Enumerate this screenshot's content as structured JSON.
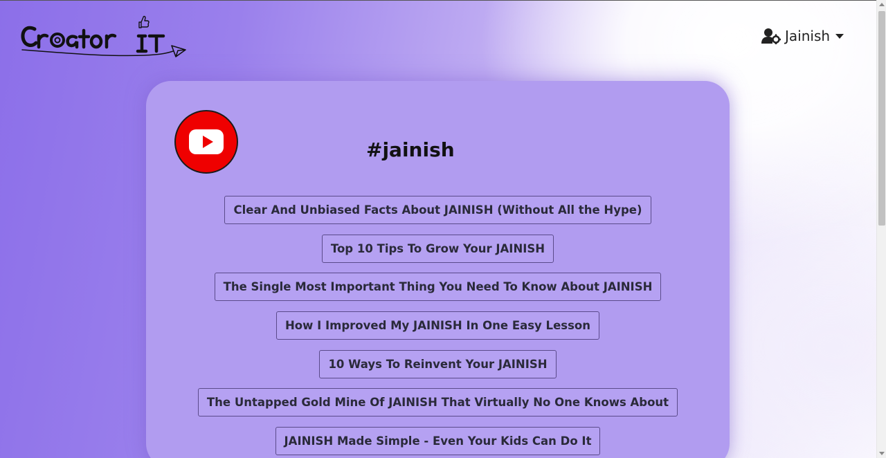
{
  "brand": {
    "logo_text": "Creator IT"
  },
  "user_menu": {
    "name": "Jainish",
    "icon": "user-gear-icon"
  },
  "card": {
    "platform_icon": "youtube-icon",
    "hashtag": "#jainish",
    "titles": [
      "Clear And Unbiased Facts About JAINISH (Without All the Hype)",
      "Top 10 Tips To Grow Your JAINISH",
      "The Single Most Important Thing You Need To Know About JAINISH",
      "How I Improved My JAINISH In One Easy Lesson",
      "10 Ways To Reinvent Your JAINISH",
      "The Untapped Gold Mine Of JAINISH That Virtually No One Knows About",
      "JAINISH Made Simple - Even Your Kids Can Do It"
    ]
  },
  "colors": {
    "card_bg": "#b19cf0",
    "youtube_red": "#ef0000",
    "bg_purple": "#8c6fe9"
  }
}
